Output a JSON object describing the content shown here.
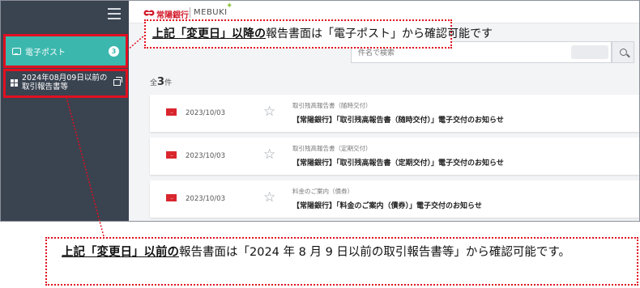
{
  "sidebar": {
    "menu_icon": "hamburger-icon",
    "items": [
      {
        "label": "電子ポスト",
        "badge": "3",
        "icon": "mailbox-icon"
      },
      {
        "label_line1": "2024年08月09日以前の",
        "label_line2": "取引報告書等",
        "icon": "grid-icon",
        "trailing_icon": "external-window-icon"
      }
    ]
  },
  "header": {
    "logo_joyo": "常陽銀行",
    "logo_mebuki": "MEBUKI"
  },
  "search": {
    "placeholder": "件名で検索",
    "button_icon": "search-icon"
  },
  "list": {
    "count_prefix": "全",
    "count": "3",
    "count_suffix": "件",
    "items": [
      {
        "date": "2023/10/03",
        "category": "取引残高報告書（随時交付）",
        "subject": "【常陽銀行】「取引残高報告書（随時交付）」電子交付のお知らせ"
      },
      {
        "date": "2023/10/03",
        "category": "取引残高報告書（定期交付）",
        "subject": "【常陽銀行】「取引残高報告書（定期交付）」電子交付のお知らせ"
      },
      {
        "date": "2023/10/03",
        "category": "料金のご案内（債券）",
        "subject": "【常陽銀行】「料金のご案内（債券）」電子交付のお知らせ"
      }
    ]
  },
  "callouts": {
    "top": {
      "highlight": "上記「変更日」以降の",
      "rest": "報告書面は「電子ポスト」から確認可能です"
    },
    "bottom": {
      "highlight": "上記「変更日」以前の",
      "rest": "報告書面は「2024 年 8 月 9 日以前の取引報告書等」から確認可能です。"
    }
  },
  "colors": {
    "sidebar_bg": "#3a4350",
    "active_item": "#3bb7ad",
    "highlight_box": "#e01020",
    "mail_icon": "#d9262e"
  }
}
